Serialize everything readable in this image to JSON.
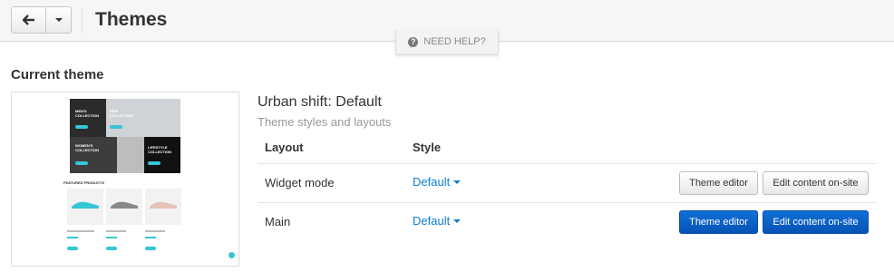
{
  "header": {
    "title": "Themes",
    "back_icon": "arrow-left-icon",
    "dropdown_icon": "caret-down-icon"
  },
  "help": {
    "label": "NEED HELP?",
    "icon": "question-circle-icon"
  },
  "current_theme": {
    "section_title": "Current theme",
    "name": "Urban shift: Default",
    "subtitle": "Theme styles and layouts",
    "preview": {
      "banners": [
        "MEN'S COLLECTION",
        "NEW COLLECTION",
        "WOMEN'S COLLECTION",
        "LIFESTYLE COLLECTION"
      ],
      "featured_label": "FEATURED PRODUCTS",
      "accent_color": "#35c6d3"
    }
  },
  "table": {
    "headers": [
      "Layout",
      "Style"
    ],
    "rows": [
      {
        "layout": "Widget mode",
        "style": "Default",
        "theme_editor": "Theme editor",
        "edit_content": "Edit content on-site",
        "variant": "default"
      },
      {
        "layout": "Main",
        "style": "Default",
        "theme_editor": "Theme editor",
        "edit_content": "Edit content on-site",
        "variant": "primary"
      }
    ]
  },
  "colors": {
    "link": "#0b7fd4",
    "primary": "#0753b5"
  }
}
